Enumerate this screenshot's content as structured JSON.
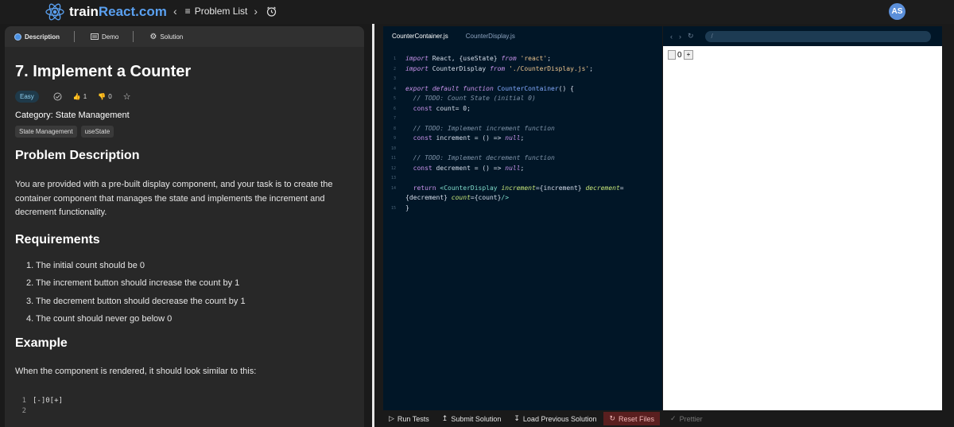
{
  "app": {
    "brand_prefix": "train",
    "brand_main": "React.com",
    "nav_label": "Problem List",
    "avatar_initials": "AS"
  },
  "left_tabs": [
    {
      "label": "Description",
      "icon": "info-icon"
    },
    {
      "label": "Demo",
      "icon": "grid-icon"
    },
    {
      "label": "Solution",
      "icon": "gear-icon"
    }
  ],
  "problem": {
    "title": "7. Implement a Counter",
    "difficulty": "Easy",
    "likes": "1",
    "dislikes": "0",
    "category": "Category: State Management",
    "tags": [
      "State Management",
      "useState"
    ],
    "description_heading": "Problem Description",
    "description": "You are provided with a pre-built display component, and your task is to create the container component that manages the state and implements the increment and decrement functionality.",
    "requirements_heading": "Requirements",
    "requirements": [
      "1.  The initial count should be 0",
      "2.  The increment button should increase the count by 1",
      "3.  The decrement button should decrease the count by 1",
      "4.  The count should never go below 0"
    ],
    "example_heading": "Example",
    "example_text": "When the component is rendered, it should look similar to this:",
    "example_code": [
      {
        "num": "1",
        "text": "[-]0[+]"
      },
      {
        "num": "2",
        "text": ""
      }
    ]
  },
  "editor": {
    "tabs": [
      "CounterContainer.js",
      "CounterDisplay.js"
    ]
  },
  "preview": {
    "url": "/",
    "count": "0",
    "increment_label": "+"
  },
  "bottom_bar": {
    "run_tests": "Run Tests",
    "submit": "Submit Solution",
    "load_previous": "Load Previous Solution",
    "reset": "Reset Files",
    "prettier": "Prettier"
  }
}
